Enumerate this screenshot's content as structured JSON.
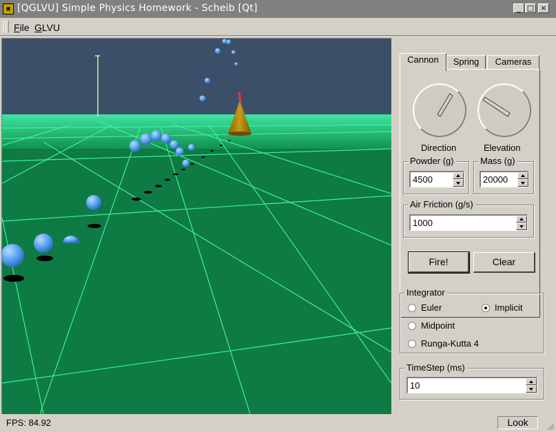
{
  "window": {
    "title": "[QGLVU] Simple Physics Homework - Scheib [Qt]",
    "icon": "qglvu-app-icon",
    "controls": [
      "minimize-icon",
      "maximize-icon",
      "close-icon"
    ]
  },
  "menubar": {
    "file_label": "File",
    "glvu_label": "GLVU"
  },
  "panel": {
    "tabs": [
      "Cannon",
      "Spring",
      "Cameras"
    ],
    "active_tab": "Cannon",
    "dials": {
      "direction_label": "Direction",
      "elevation_label": "Elevation"
    },
    "powder": {
      "label": "Powder (g)",
      "value": "4500"
    },
    "mass": {
      "label": "Mass (g)",
      "value": "20000"
    },
    "air_friction": {
      "label": "Air Friction (g/s)",
      "value": "1000"
    },
    "fire_label": "Fire!",
    "clear_label": "Clear",
    "integrator": {
      "label": "Integrator",
      "options": [
        "Euler",
        "Implicit",
        "Midpoint",
        "Runga-Kutta 4"
      ],
      "selected": "Implicit"
    },
    "timestep": {
      "label": "TimeStep (ms)",
      "value": "10"
    }
  },
  "status": {
    "fps": "FPS: 84.92",
    "mode": "Look"
  },
  "colors": {
    "sky": "#3b5068",
    "ground": "#0e7a44",
    "grid": "#3ef29a",
    "horizon": "#3cf5a8",
    "sphere": "#5aa6f0",
    "cone": "#b58a10",
    "titlebar": "#808080"
  }
}
